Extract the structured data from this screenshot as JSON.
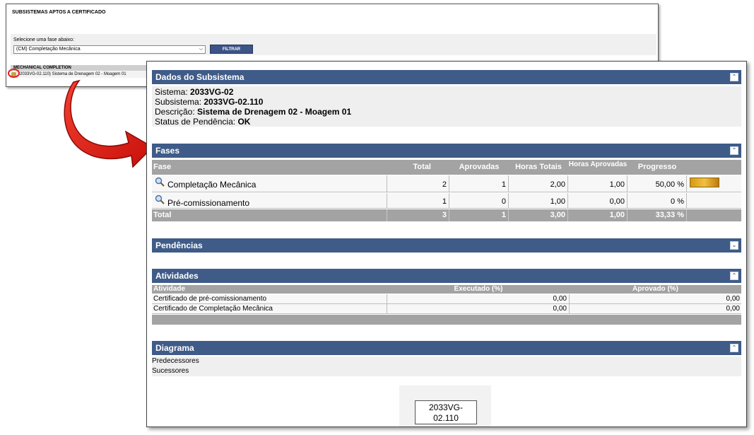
{
  "back_window": {
    "title": "SUBSISTEMAS APTOS A CERTIFICADO",
    "filter_label": "Selecione uma fase abaixo:",
    "phase_select_value": "(CM) Completação Mecânica",
    "filter_button": "FILTRAR",
    "group_header": "MECHANICAL COMPLETION",
    "row_text": "2033VG-02.110) Sistema de Drenagem 02 - Moagem 01"
  },
  "front_window": {
    "dados": {
      "title": "Dados do Subsistema",
      "toggle_icon": "collapse-up-icon",
      "sistema_label": "Sistema:",
      "sistema_value": "2033VG-02",
      "subsistema_label": "Subsistema:",
      "subsistema_value": "2033VG-02.110",
      "descricao_label": "Descrição:",
      "descricao_value": "Sistema de Drenagem 02 - Moagem 01",
      "status_label": "Status de Pendência:",
      "status_value": "OK"
    },
    "fases": {
      "title": "Fases",
      "toggle_icon": "collapse-up-icon",
      "columns": {
        "fase": "Fase",
        "total": "Total",
        "aprovadas": "Aprovadas",
        "horas_totais": "Horas Totais",
        "horas_aprovadas": "Horas Aprovadas",
        "progresso": "Progresso"
      },
      "rows": [
        {
          "fase": "Completação Mecânica",
          "total": "2",
          "aprovadas": "1",
          "horas_totais": "2,00",
          "horas_aprovadas": "1,00",
          "progresso": "50,00 %",
          "progress_fraction": 0.5
        },
        {
          "fase": "Pré-comissionamento",
          "total": "1",
          "aprovadas": "0",
          "horas_totais": "1,00",
          "horas_aprovadas": "0,00",
          "progresso": "0 %",
          "progress_fraction": 0
        }
      ],
      "total_row": {
        "fase": "Total",
        "total": "3",
        "aprovadas": "1",
        "horas_totais": "3,00",
        "horas_aprovadas": "1,00",
        "progresso": "33,33 %"
      }
    },
    "pendencias": {
      "title": "Pendências",
      "toggle_icon": "expand-down-icon"
    },
    "atividades": {
      "title": "Atividades",
      "toggle_icon": "collapse-up-icon",
      "columns": {
        "atividade": "Atividade",
        "executado": "Executado (%)",
        "aprovado": "Aprovado (%)"
      },
      "rows": [
        {
          "atividade": "Certificado de pré-comissionamento",
          "executado": "0,00",
          "aprovado": "0,00"
        },
        {
          "atividade": "Certificado de Completação Mecânica",
          "executado": "0,00",
          "aprovado": "0,00"
        }
      ]
    },
    "diagrama": {
      "title": "Diagrama",
      "toggle_icon": "collapse-up-icon",
      "predecessores": "Predecessores",
      "sucessores": "Sucessores",
      "node_line1": "2033VG-",
      "node_line2": "02.110"
    }
  },
  "colors": {
    "panel_header": "#3f5b88",
    "table_header": "#a3a3a3",
    "arrow": "#e0201a",
    "progress": "#e0a020"
  }
}
